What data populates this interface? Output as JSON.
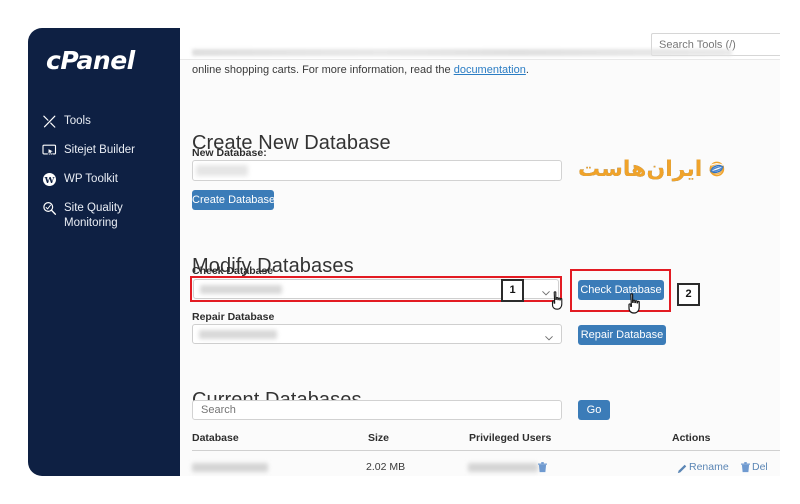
{
  "app": {
    "name": "cPanel",
    "logo_text": "cPanel"
  },
  "topbar": {
    "search_placeholder": "Search Tools (/)",
    "search_value": ""
  },
  "sidebar": {
    "items": [
      {
        "label": "Tools",
        "icon": "tools-icon"
      },
      {
        "label": "Sitejet Builder",
        "icon": "monitor-cursor-icon"
      },
      {
        "label": "WP Toolkit",
        "icon": "wordpress-icon"
      },
      {
        "label": "Site Quality Monitoring",
        "icon": "magnifier-icon"
      }
    ]
  },
  "intro": {
    "text_before": "online shopping carts. For more information, read the ",
    "link_text": "documentation",
    "text_after": "."
  },
  "create_section": {
    "heading": "Create New Database",
    "field_label": "New Database:",
    "input_value": "",
    "input_placeholder": "",
    "button_label": "Create Database"
  },
  "modify_section": {
    "heading": "Modify Databases",
    "check_label": "Check Database",
    "check_select_value": "",
    "check_button_label": "Check Database",
    "repair_label": "Repair Database",
    "repair_select_value": "",
    "repair_button_label": "Repair Database"
  },
  "current_section": {
    "heading": "Current Databases",
    "search_placeholder": "Search",
    "search_value": "",
    "go_button_label": "Go",
    "columns": [
      "Database",
      "Size",
      "Privileged Users",
      "Actions"
    ],
    "rows": [
      {
        "database": "",
        "size": "2.02 MB",
        "privileged_users": "",
        "actions": [
          "Rename",
          "Del"
        ]
      }
    ]
  },
  "annotations": {
    "steps": [
      {
        "number": "1",
        "target": "check-database-select"
      },
      {
        "number": "2",
        "target": "check-database-button"
      }
    ],
    "highlight_color": "#e31b23"
  },
  "watermark": {
    "text": "ایران‌هاست",
    "colors": {
      "orange": "#f0a32a",
      "blue": "#2f72c4"
    }
  },
  "colors": {
    "sidebar_bg": "#0e2043",
    "primary_button": "#3b7cb8",
    "link": "#2b7dc4",
    "page_bg": "#fbfbfb"
  }
}
